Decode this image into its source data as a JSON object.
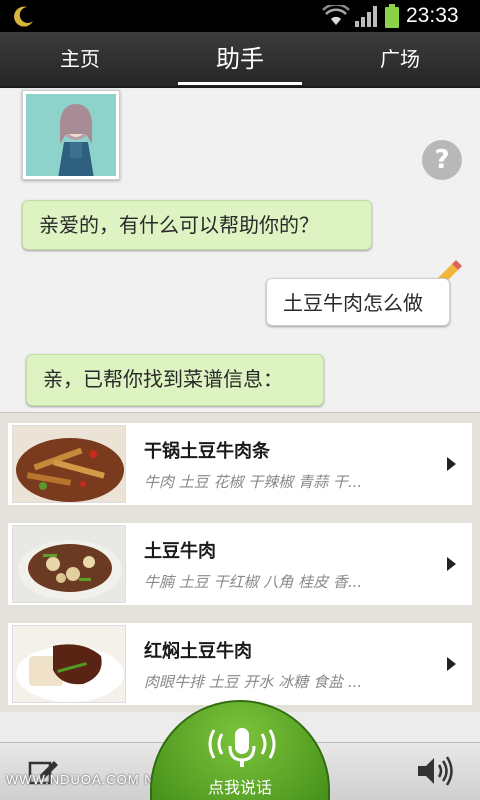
{
  "status": {
    "time": "23:33"
  },
  "tabs": [
    {
      "label": "主页"
    },
    {
      "label": "助手"
    },
    {
      "label": "广场"
    }
  ],
  "chat": {
    "help_label": "?",
    "messages": [
      {
        "from": "assistant",
        "text": "亲爱的，有什么可以帮助你的？"
      },
      {
        "from": "user",
        "text": "土豆牛肉怎么做"
      },
      {
        "from": "assistant",
        "text": "亲，已帮你找到菜谱信息："
      }
    ]
  },
  "recipes": [
    {
      "title": "干锅土豆牛肉条",
      "ingredients": "牛肉 土豆 花椒 干辣椒 青蒜 干..."
    },
    {
      "title": "土豆牛肉",
      "ingredients": "牛腩 土豆 干红椒 八角 桂皮 香..."
    },
    {
      "title": "红焖土豆牛肉",
      "ingredients": "肉眼牛排 土豆 开水 冰糖 食盐 ..."
    }
  ],
  "bottom": {
    "voice_label": "点我说话",
    "watermark": "WWW.NDUOA.COM N多网"
  },
  "colors": {
    "accent_green": "#5aa824",
    "bubble_in": "#ddf3c2"
  }
}
